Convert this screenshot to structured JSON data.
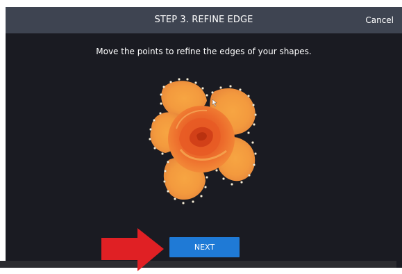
{
  "header": {
    "title": "STEP 3. REFINE EDGE",
    "cancel_label": "Cancel"
  },
  "main": {
    "instruction": "Move the points to refine the edges of your shapes."
  },
  "footer": {
    "next_label": "NEXT"
  },
  "colors": {
    "header_bg": "#3e4451",
    "dialog_bg": "#1a1b22",
    "accent": "#1f7ad6",
    "arrow": "#e02024"
  },
  "icons": {
    "annotation": "red-arrow-icon",
    "image": "rose-image"
  }
}
